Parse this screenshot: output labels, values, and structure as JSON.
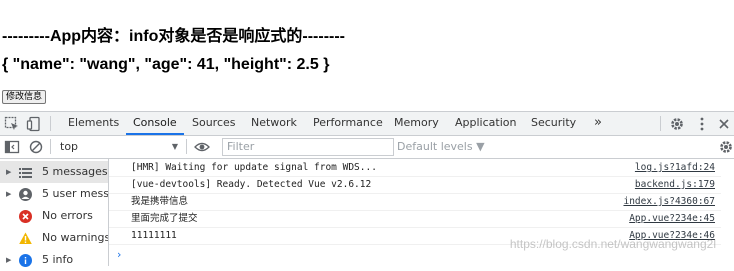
{
  "app": {
    "heading": "---------App内容：info对象是否是响应式的--------",
    "info_display": "{ \"name\": \"wang\", \"age\": 41, \"height\": 2.5 }",
    "modify_button": "修改信息"
  },
  "devtools": {
    "tabs": [
      "Elements",
      "Console",
      "Sources",
      "Network",
      "Performance",
      "Memory",
      "Application",
      "Security"
    ],
    "more_tabs": "»",
    "context": "top",
    "filter_placeholder": "Filter",
    "levels": "Default levels ▼",
    "sidebar": [
      {
        "label": "5 messages",
        "icon": "list-icon",
        "color": "#5f6368"
      },
      {
        "label": "5 user mess...",
        "icon": "user-icon",
        "color": "#5f6368"
      },
      {
        "label": "No errors",
        "icon": "error-icon",
        "color": "#d93025"
      },
      {
        "label": "No warnings",
        "icon": "warning-icon",
        "color": "#f2b600"
      },
      {
        "label": "5 info",
        "icon": "info-icon",
        "color": "#1a73e8"
      }
    ],
    "messages": [
      {
        "text": "[HMR] Waiting for update signal from WDS...",
        "source": "log.js?1afd:24"
      },
      {
        "text": "[vue-devtools] Ready. Detected Vue v2.6.12",
        "source": "backend.js:179"
      },
      {
        "text": "我是携带信息",
        "source": "index.js?4360:67"
      },
      {
        "text": "里面完成了提交",
        "source": "App.vue?234e:45"
      },
      {
        "text": "11111111",
        "source": "App.vue?234e:46"
      }
    ],
    "watermark": "https://blog.csdn.net/wangwangwang2l"
  }
}
